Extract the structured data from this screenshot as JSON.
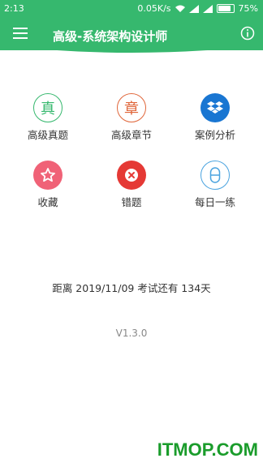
{
  "status_bar": {
    "time": "2:13",
    "speed": "0.05K/s",
    "battery": "75%",
    "battery_level": 0.75
  },
  "header": {
    "title": "高级-系统架构设计师"
  },
  "grid": [
    {
      "label": "高级真题",
      "icon": "zhen-character-icon",
      "color": "#36b86e"
    },
    {
      "label": "高级章节",
      "icon": "zhang-character-icon",
      "color": "#e0663a"
    },
    {
      "label": "案例分析",
      "icon": "dropbox-icon",
      "color": "#1976d2"
    },
    {
      "label": "收藏",
      "icon": "star-icon",
      "color": "#f06277"
    },
    {
      "label": "错题",
      "icon": "close-circle-icon",
      "color": "#e53935"
    },
    {
      "label": "每日一练",
      "icon": "capsule-icon",
      "color": "#4aa3df"
    }
  ],
  "countdown": "距离 2019/11/09 考试还有 134天",
  "version": "V1.3.0",
  "watermark": "ITMOP.COM"
}
